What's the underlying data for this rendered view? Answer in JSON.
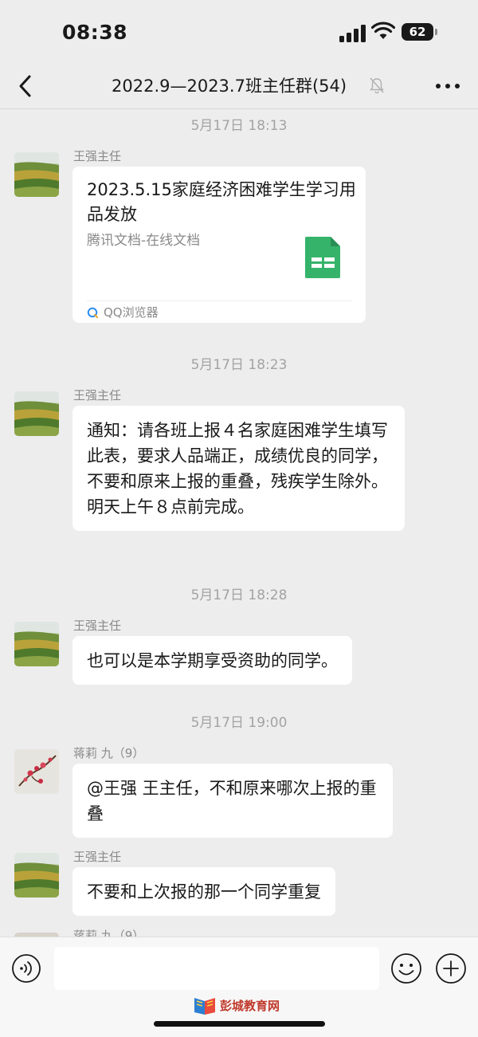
{
  "status_bar": {
    "time": "08:38",
    "battery": "62"
  },
  "nav": {
    "title": "2022.9—2023.7班主任群(54)"
  },
  "messages": [
    {
      "timestamp": "5月17日 18:13",
      "sender": "王强主任",
      "card": {
        "title": "2023.5.15家庭经济困难学生学习用品发放",
        "subtitle": "腾讯文档-在线文档",
        "source": "QQ浏览器"
      }
    },
    {
      "timestamp": "5月17日 18:23",
      "sender": "王强主任",
      "text": "通知：请各班上报４名家庭困难学生填写此表，要求人品端正，成绩优良的同学，不要和原来上报的重叠，残疾学生除外。明天上午８点前完成。"
    },
    {
      "timestamp": "5月17日 18:28",
      "sender": "王强主任",
      "text": "也可以是本学期享受资助的同学。"
    },
    {
      "timestamp": "5月17日 19:00",
      "sender": "蒋莉 九（9）",
      "text": "@王强 王主任，不和原来哪次上报的重叠"
    },
    {
      "sender": "王强主任",
      "text": "不要和上次报的那一个同学重复"
    },
    {
      "sender": "蒋莉 九（9）"
    }
  ],
  "input": {
    "placeholder": ""
  },
  "watermark": "彭城教育网",
  "colors": {
    "background": "#ededed",
    "bubble": "#ffffff",
    "doc_icon": "#35b36b"
  },
  "icons": [
    "back-arrow-icon",
    "mute-bell-icon",
    "more-icon",
    "voice-icon",
    "emoji-icon",
    "plus-icon",
    "spreadsheet-icon",
    "qq-browser-icon"
  ]
}
